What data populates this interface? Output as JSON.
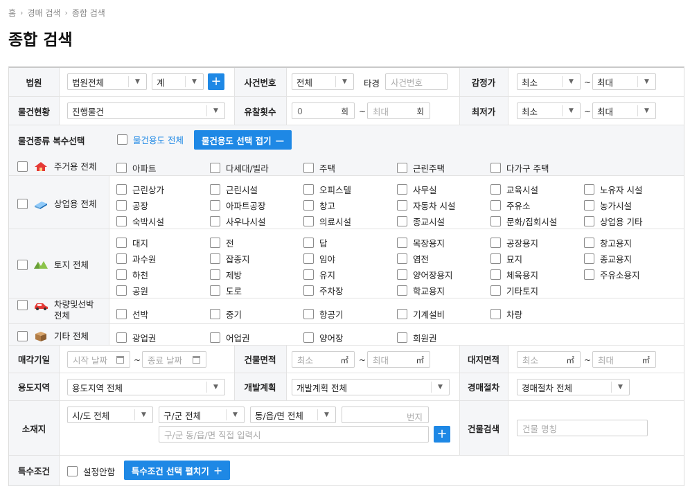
{
  "breadcrumb": [
    "홈",
    "경매 검색",
    "종합 검색"
  ],
  "page_title": "종합 검색",
  "row1": {
    "court_label": "법원",
    "court_value": "법원전체",
    "court_sub_value": "계",
    "case_label": "사건번호",
    "case_year_value": "전체",
    "case_other_label": "타경",
    "case_number_placeholder": "사건번호",
    "appraisal_label": "감정가",
    "appraisal_min": "최소",
    "appraisal_max": "최대"
  },
  "row2": {
    "status_label": "물건현황",
    "status_value": "진행물건",
    "failed_label": "유찰횟수",
    "failed_min_value": "0",
    "failed_max_placeholder": "최대",
    "count_unit": "회",
    "lowest_label": "최저가",
    "lowest_min": "최소",
    "lowest_max": "최대"
  },
  "types": {
    "label": "물건종류 복수선택",
    "all_usage_label": "물건용도 전체",
    "collapse_button": "물건용도 선택 접기",
    "collapse_symbol": "—",
    "categories": [
      {
        "label": "주거용 전체",
        "icon": "house-icon",
        "items": [
          "아파트",
          "다세대/빌라",
          "주택",
          "근린주택",
          "다가구 주택"
        ]
      },
      {
        "label": "상업용 전체",
        "icon": "building-icon",
        "items": [
          "근린상가",
          "근린시설",
          "오피스텔",
          "사무실",
          "교육시설",
          "노유자 시설",
          "공장",
          "아파트공장",
          "창고",
          "자동차 시설",
          "주유소",
          "농가시설",
          "숙박시설",
          "사우나시설",
          "의료시설",
          "종교시설",
          "문화/집회시설",
          "상업용 기타"
        ]
      },
      {
        "label": "토지 전체",
        "icon": "land-icon",
        "items": [
          "대지",
          "전",
          "답",
          "목장용지",
          "공장용지",
          "창고용지",
          "과수원",
          "잡종지",
          "임야",
          "염전",
          "묘지",
          "종교용지",
          "하천",
          "제방",
          "유지",
          "양어장용지",
          "체육용지",
          "주유소용지",
          "공원",
          "도로",
          "주차장",
          "학교용지",
          "기타토지"
        ]
      },
      {
        "label_lines": [
          "차량및선박",
          "전체"
        ],
        "icon": "car-icon",
        "items": [
          "선박",
          "중기",
          "항공기",
          "기계설비",
          "차량"
        ]
      },
      {
        "label": "기타 전체",
        "icon": "box-icon",
        "items": [
          "광업권",
          "어업권",
          "양어장",
          "회원권"
        ]
      }
    ]
  },
  "row_date": {
    "closing_label": "매각기일",
    "start_placeholder": "시작 날짜",
    "end_placeholder": "종료 날짜",
    "building_area_label": "건물면적",
    "area_min": "최소",
    "area_max": "최대",
    "area_unit": "㎡",
    "land_area_label": "대지면적"
  },
  "row_zone": {
    "zone_label": "용도지역",
    "zone_value": "용도지역 전체",
    "dev_label": "개발계획",
    "dev_value": "개발계획 전체",
    "proc_label": "경매절차",
    "proc_value": "경매절차 전체"
  },
  "row_location": {
    "label": "소재지",
    "sido_value": "시/도 전체",
    "gugun_value": "구/군 전체",
    "dong_value": "동/읍/면 전체",
    "bunji_placeholder": "번지",
    "direct_placeholder": "구/군 동/읍/면 직접 입력시",
    "building_search_label": "건물검색",
    "building_name_placeholder": "건물 명칭"
  },
  "row_special": {
    "label": "특수조건",
    "none_label": "설정안함",
    "expand_button": "특수조건 선택 펼치기",
    "expand_symbol": "+"
  },
  "colors": {
    "accent": "#1e88e5",
    "label_bg": "#f5f6f8",
    "border": "#e3e3e3"
  }
}
